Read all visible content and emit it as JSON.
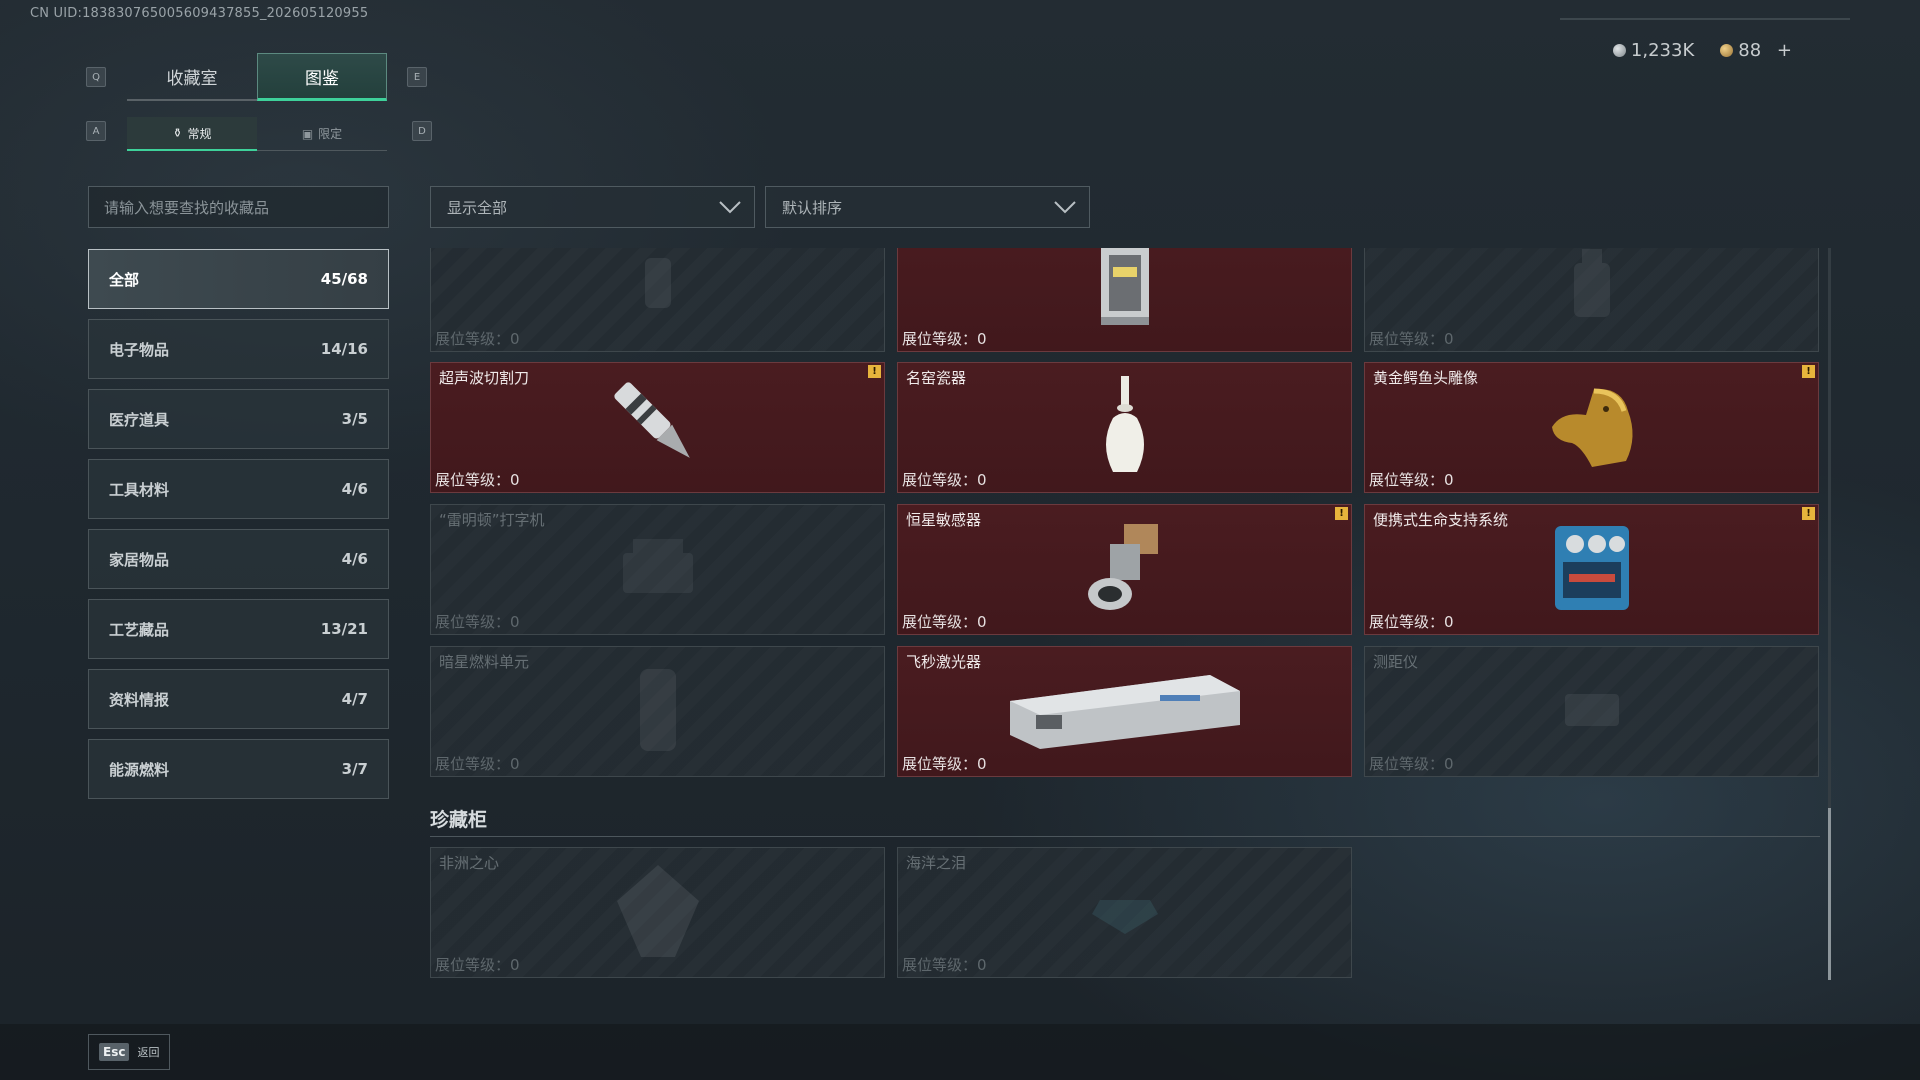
{
  "uid": "CN UID:18383076500560943​7855_202605120955",
  "keys": {
    "prev_main": "Q",
    "next_main": "E",
    "prev_sub": "A",
    "next_sub": "D"
  },
  "tabs": [
    {
      "label": "收藏室",
      "active": false
    },
    {
      "label": "图鉴",
      "active": true
    }
  ],
  "subtabs": [
    {
      "label": "常规",
      "active": true
    },
    {
      "label": "限定",
      "active": false
    }
  ],
  "currency": {
    "silver": "1,233K",
    "gold": "88",
    "add": "+"
  },
  "search": {
    "placeholder": "请输入想要查找的收藏品"
  },
  "filters": {
    "show": "显示全部",
    "sort": "默认排序"
  },
  "categories": [
    {
      "label": "全部",
      "count": "45/68",
      "active": true
    },
    {
      "label": "电子物品",
      "count": "14/16"
    },
    {
      "label": "医疗道具",
      "count": "3/5"
    },
    {
      "label": "工具材料",
      "count": "4/6"
    },
    {
      "label": "家居物品",
      "count": "4/6"
    },
    {
      "label": "工艺藏品",
      "count": "13/21"
    },
    {
      "label": "资料情报",
      "count": "4/7"
    },
    {
      "label": "能源燃料",
      "count": "3/7"
    }
  ],
  "level_label": "展位等级：0",
  "items": [
    {
      "name": "",
      "owned": false,
      "warn": false,
      "icon": "vase-icon"
    },
    {
      "name": "",
      "owned": true,
      "warn": false,
      "icon": "lantern-icon"
    },
    {
      "name": "",
      "owned": false,
      "warn": false,
      "icon": "bottle-icon"
    },
    {
      "name": "超声波切割刀",
      "owned": true,
      "warn": true,
      "icon": "knife-icon"
    },
    {
      "name": "名窑瓷器",
      "owned": true,
      "warn": false,
      "icon": "porcelain-icon"
    },
    {
      "name": "黄金鳄鱼头雕像",
      "owned": true,
      "warn": true,
      "icon": "crocodile-head-icon"
    },
    {
      "name": "“雷明顿”打字机",
      "owned": false,
      "warn": false,
      "icon": "typewriter-icon"
    },
    {
      "name": "恒星敏感器",
      "owned": true,
      "warn": true,
      "icon": "star-sensor-icon"
    },
    {
      "name": "便携式生命支持系统",
      "owned": true,
      "warn": true,
      "icon": "life-support-icon"
    },
    {
      "name": "暗星燃料单元",
      "owned": false,
      "warn": false,
      "icon": "fuel-cell-icon"
    },
    {
      "name": "飞秒激光器",
      "owned": true,
      "warn": false,
      "icon": "laser-icon"
    },
    {
      "name": "测距仪",
      "owned": false,
      "warn": false,
      "icon": "rangefinder-icon"
    }
  ],
  "cabinet": {
    "title": "珍藏柜",
    "items": [
      {
        "name": "非洲之心",
        "owned": false,
        "icon": "diamond-icon"
      },
      {
        "name": "海洋之泪",
        "owned": false,
        "icon": "gem-icon"
      }
    ]
  },
  "footer": {
    "esc_key": "Esc",
    "back_label": "返回"
  },
  "warn_glyph": "!"
}
